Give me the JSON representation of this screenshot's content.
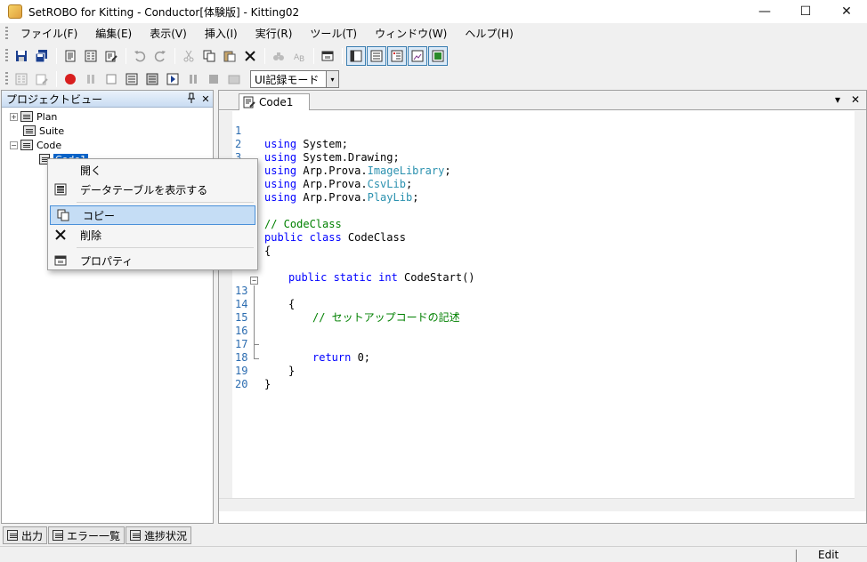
{
  "window": {
    "title": "SetROBO for Kitting - Conductor[体験版] - Kitting02",
    "minimize": "—",
    "maximize": "☐",
    "close": "✕"
  },
  "menu": [
    "ファイル(F)",
    "編集(E)",
    "表示(V)",
    "挿入(I)",
    "実行(R)",
    "ツール(T)",
    "ウィンドウ(W)",
    "ヘルプ(H)"
  ],
  "toolbar2": {
    "mode_value": "UI記録モード",
    "dropdown_arrow": "▾"
  },
  "project_view": {
    "title": "プロジェクトビュー",
    "pin": "📌",
    "close": "✕",
    "tree": [
      {
        "label": "Plan",
        "expander": "+"
      },
      {
        "label": "Suite",
        "expander": ""
      },
      {
        "label": "Code",
        "expander": "−"
      }
    ],
    "selected_child": "Code1"
  },
  "context_menu": [
    {
      "label": "開く",
      "icon": ""
    },
    {
      "label": "データテーブルを表示する",
      "icon": "table-icon"
    },
    {
      "label": "コピー",
      "icon": "copy-icon",
      "highlighted": true
    },
    {
      "label": "削除",
      "icon": "delete-icon"
    },
    {
      "label": "プロパティ",
      "icon": "properties-icon"
    }
  ],
  "editor": {
    "tab_label": "Code1",
    "tab_menu": "▾",
    "tab_close": "✕",
    "line_numbers": [
      "1",
      "2",
      "3",
      "4",
      "5",
      "",
      "",
      "",
      "",
      "",
      "",
      "",
      "13",
      "14",
      "15",
      "16",
      "17",
      "18",
      "19",
      "20"
    ],
    "code": {
      "l1_kw": "using",
      "l1_rest": " System;",
      "l2_kw": "using",
      "l2_rest": " System.Drawing;",
      "l3_kw": "using",
      "l3_a": " Arp.Prova.",
      "l3_t": "ImageLibrary",
      "l3_b": ";",
      "l4_kw": "using",
      "l4_a": " Arp.Prova.",
      "l4_t": "CsvLib",
      "l4_b": ";",
      "l5_kw": "using",
      "l5_a": " Arp.Prova.",
      "l5_t": "PlayLib",
      "l5_b": ";",
      "l8_cm": "// CodeClass",
      "l9_kw": "public class",
      "l9_rest": " CodeClass",
      "l10": "{",
      "l12_kw": "public static int",
      "l12_rest": " CodeStart()",
      "l13": "{",
      "l14_cm": "// セットアップコードの記述",
      "l17_kw": "return",
      "l17_rest": " 0;",
      "l18": "}",
      "l19": "}"
    }
  },
  "bottom_tabs": [
    "出力",
    "エラー一覧",
    "進捗状況"
  ],
  "status": {
    "mode": "Edit"
  }
}
